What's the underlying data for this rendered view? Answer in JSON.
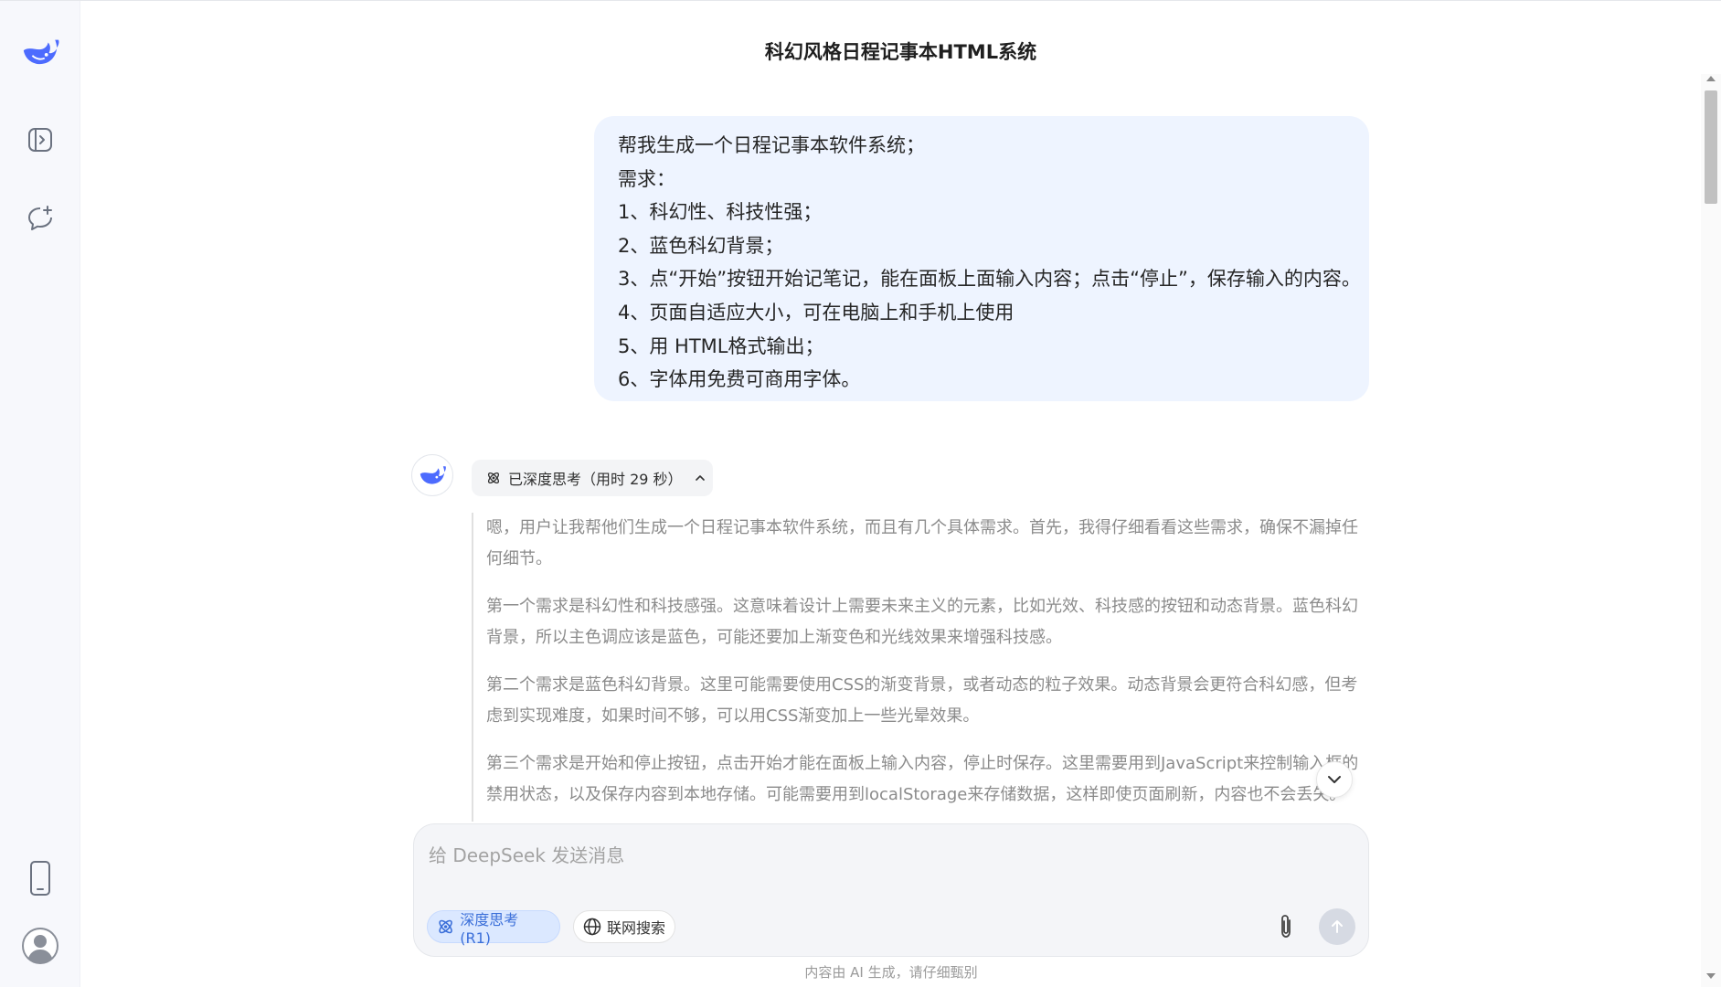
{
  "header": {
    "title": "科幻风格日程记事本HTML系统"
  },
  "sidebar": {
    "icons": [
      "deepseek-logo",
      "open-sidebar-icon",
      "new-chat-icon",
      "mobile-app-icon",
      "user-avatar-icon"
    ]
  },
  "user_message": {
    "lines": [
      "帮我生成一个日程记事本软件系统；",
      "需求：",
      "1、科幻性、科技性强；",
      "2、蓝色科幻背景；",
      "3、点“开始”按钮开始记笔记，能在面板上面输入内容；点击“停止”，保存输入的内容。",
      "4、页面自适应大小，可在电脑上和手机上使用",
      "5、用 HTML格式输出；",
      "6、字体用免费可商用字体。"
    ]
  },
  "assistant": {
    "thinking_label": "已深度思考（用时 29 秒）",
    "reasoning": [
      "嗯，用户让我帮他们生成一个日程记事本软件系统，而且有几个具体需求。首先，我得仔细看看这些需求，确保不漏掉任何细节。",
      "第一个需求是科幻性和科技感强。这意味着设计上需要未来主义的元素，比如光效、科技感的按钮和动态背景。蓝色科幻背景，所以主色调应该是蓝色，可能还要加上渐变色和光线效果来增强科技感。",
      "第二个需求是蓝色科幻背景。这里可能需要使用CSS的渐变背景，或者动态的粒子效果。动态背景会更符合科幻感，但考虑到实现难度，如果时间不够，可以用CSS渐变加上一些光晕效果。",
      "第三个需求是开始和停止按钮，点击开始才能在面板上输入内容，停止时保存。这里需要用到JavaScript来控制输入框的禁用状态，以及保存内容到本地存储。可能需要用到localStorage来存储数据，这样即使页面刷新，内容也不会丢失。"
    ]
  },
  "composer": {
    "placeholder": "给 DeepSeek 发送消息",
    "value": "",
    "deep_think_label": "深度思考 (R1)",
    "web_search_label": "联网搜索"
  },
  "footer": {
    "disclaimer": "内容由 AI 生成，请仔细甄别"
  },
  "colors": {
    "accent": "#4d6bfe",
    "user_bubble": "#eef4ff",
    "reasoning_text": "#8b8b8b"
  }
}
